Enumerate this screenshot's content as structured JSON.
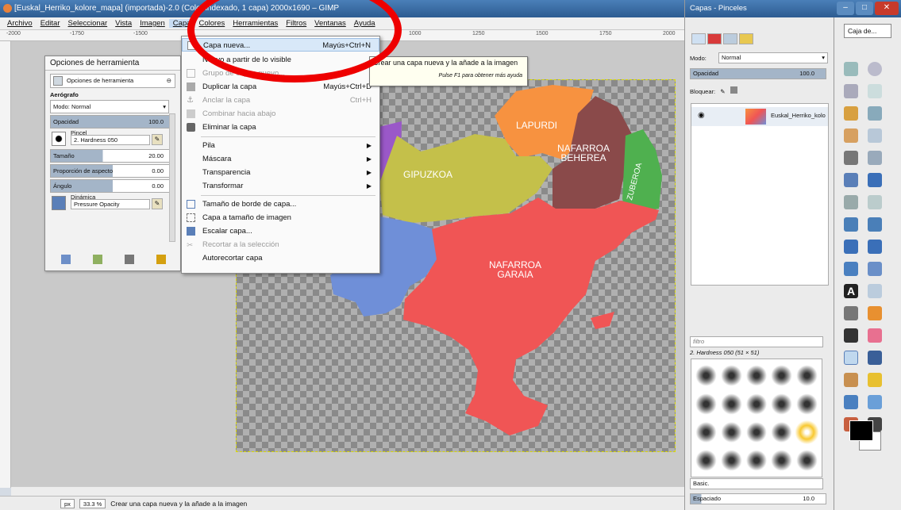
{
  "window": {
    "title": "[Euskal_Herriko_kolore_mapa] (importada)-2.0 (Color indexado, 1 capa) 2000x1690 – GIMP"
  },
  "menubar": {
    "items": [
      "Archivo",
      "Editar",
      "Seleccionar",
      "Vista",
      "Imagen",
      "Capa",
      "Colores",
      "Herramientas",
      "Filtros",
      "Ventanas",
      "Ayuda"
    ]
  },
  "ruler": {
    "ticks": [
      "-2000",
      "-1750",
      "-1500",
      "1000",
      "1250",
      "1500",
      "1750",
      "2000"
    ]
  },
  "map": {
    "regions": [
      "LAPURDI",
      "NAFARROA\nBEHEREA",
      "GIPUZKOA",
      "ZUBEROA",
      "NAFARROA\nGARAIA"
    ],
    "colors": {
      "lapurdi": "#f79240",
      "behera": "#8a4a4a",
      "gipuzkoa": "#c4c04a",
      "zuberoa": "#4fb04f",
      "garaia": "#f05555",
      "blue": "#6f8fd8",
      "purple": "#9a58c8"
    }
  },
  "tool_options": {
    "title": "Opciones de herramienta",
    "tab_label": "Opciones de herramienta",
    "tool_name": "Aerógrafo",
    "mode_label": "Modo:",
    "mode_value": "Normal",
    "opacity_label": "Opacidad",
    "opacity_value": "100.0",
    "brush_label": "Pincel",
    "brush_name": "2. Hardness 050",
    "size_label": "Tamaño",
    "size_value": "20.00",
    "aspect_label": "Proporción de aspecto",
    "aspect_value": "0.00",
    "angle_label": "Ángulo",
    "angle_value": "0.00",
    "dynamics_label": "Dinámica",
    "dynamics_value": "Pressure Opacity"
  },
  "capa_menu": {
    "items": [
      {
        "label": "Capa nueva...",
        "shortcut": "Mayús+Ctrl+N"
      },
      {
        "label": "Nuevo a partir de lo visible",
        "shortcut": ""
      },
      {
        "label": "Grupo de capas nuevo...",
        "shortcut": ""
      },
      {
        "label": "Duplicar la capa",
        "shortcut": "Mayús+Ctrl+D"
      },
      {
        "label": "Anclar la capa",
        "shortcut": "Ctrl+H"
      },
      {
        "label": "Combinar hacia abajo",
        "shortcut": ""
      },
      {
        "label": "Eliminar la capa",
        "shortcut": ""
      },
      {
        "label": "Pila",
        "shortcut": ""
      },
      {
        "label": "Máscara",
        "shortcut": ""
      },
      {
        "label": "Transparencia",
        "shortcut": ""
      },
      {
        "label": "Transformar",
        "shortcut": ""
      },
      {
        "label": "Tamaño de borde de capa...",
        "shortcut": ""
      },
      {
        "label": "Capa a tamaño de imagen",
        "shortcut": ""
      },
      {
        "label": "Escalar capa...",
        "shortcut": ""
      },
      {
        "label": "Recortar a la selección",
        "shortcut": ""
      },
      {
        "label": "Autorecortar capa",
        "shortcut": ""
      }
    ]
  },
  "tooltip": {
    "text": "Crear una capa nueva y la añade a la imagen",
    "hint": "Pulse F1 para obtener más ayuda"
  },
  "status": {
    "unit": "px",
    "zoom": "33.3 %",
    "message": "Crear una capa nueva y la añade a la imagen"
  },
  "dock": {
    "title": "Capas - Pinceles",
    "mode_label": "Modo:",
    "mode_value": "Normal",
    "opacity_label": "Opacidad",
    "opacity_value": "100.0",
    "lock_label": "Bloquear:",
    "layer_name": "Euskal_Herriko_kolo",
    "filter_placeholder": "filtro",
    "brush_info": "2. Hardness 050 (51 × 51)",
    "preset": "Basic.",
    "spacing_label": "Espaciado",
    "spacing_value": "10.0"
  },
  "toolbox": {
    "title": "Caja de..."
  }
}
